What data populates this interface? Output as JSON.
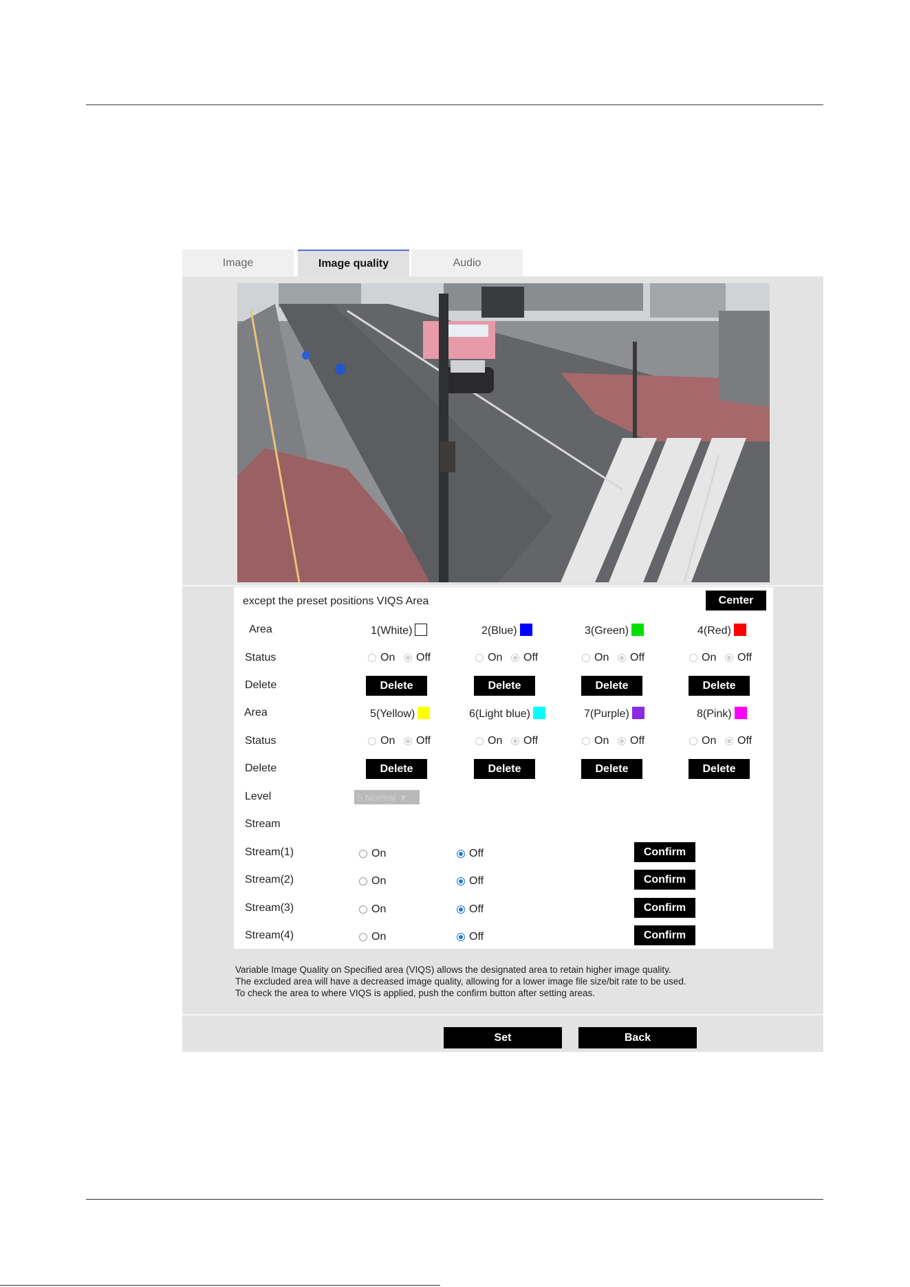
{
  "tabs": [
    {
      "label": "Image",
      "active": false
    },
    {
      "label": "Image quality",
      "active": true
    },
    {
      "label": "Audio",
      "active": false
    }
  ],
  "viqs": {
    "header": "except the preset positions  VIQS Area",
    "center_label": "Center",
    "row_labels": {
      "area": "Area",
      "status": "Status",
      "delete": "Delete"
    },
    "areas": [
      {
        "label": "1(White)",
        "color": "#ffffff"
      },
      {
        "label": "2(Blue)",
        "color": "#0000ff"
      },
      {
        "label": "3(Green)",
        "color": "#00e000"
      },
      {
        "label": "4(Red)",
        "color": "#ff0000"
      },
      {
        "label": "5(Yellow)",
        "color": "#ffff00"
      },
      {
        "label": "6(Light blue)",
        "color": "#00ffff"
      },
      {
        "label": "7(Purple)",
        "color": "#8a2be2"
      },
      {
        "label": "8(Pink)",
        "color": "#ff00ff"
      }
    ],
    "on_label": "On",
    "off_label": "Off",
    "delete_label": "Delete",
    "level_label": "Level",
    "level_value": "5 Normal",
    "stream_label": "Stream",
    "streams": [
      {
        "label": "Stream(1)",
        "value": "Off"
      },
      {
        "label": "Stream(2)",
        "value": "Off"
      },
      {
        "label": "Stream(3)",
        "value": "Off"
      },
      {
        "label": "Stream(4)",
        "value": "Off"
      }
    ],
    "confirm_label": "Confirm"
  },
  "note": {
    "line1": "Variable Image Quality on Specified area (VIQS) allows the designated area to retain higher image quality.",
    "line2": "The excluded area will have a decreased image quality, allowing for a lower image file size/bit rate to be used.",
    "line3": "To check the area to where VIQS is applied, push the confirm button after setting areas."
  },
  "footer": {
    "set_label": "Set",
    "back_label": "Back"
  },
  "colors": {
    "panel": "#e3e3e3",
    "tab_accent": "#5a6fcf",
    "radio_selected": "#1a73e8",
    "button": "#000000"
  }
}
